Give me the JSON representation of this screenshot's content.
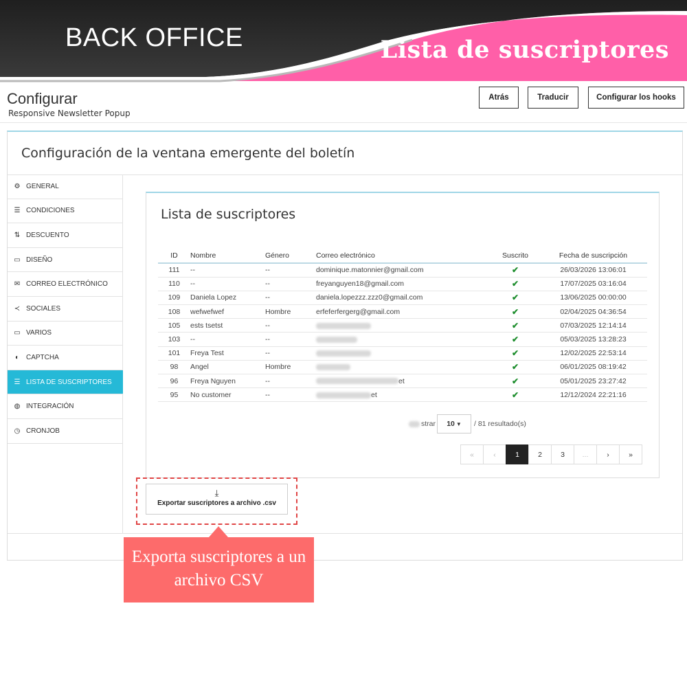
{
  "banner": {
    "left_title": "BACK OFFICE",
    "right_title": "Lista de suscriptores",
    "colors": {
      "dark": "#2b2b2b",
      "pink": "#ff5fa8"
    }
  },
  "header": {
    "title": "Configurar",
    "subtitle": "Responsive Newsletter Popup",
    "buttons": {
      "back": "Atrás",
      "translate": "Traducir",
      "hooks": "Configurar los hooks"
    }
  },
  "panel": {
    "title": "Configuración de la ventana emergente del boletín"
  },
  "sidebar": {
    "items": [
      {
        "label": "GENERAL",
        "icon": "cogs-icon"
      },
      {
        "label": "CONDICIONES",
        "icon": "list-icon"
      },
      {
        "label": "DESCUENTO",
        "icon": "sort-icon"
      },
      {
        "label": "DISEÑO",
        "icon": "window-icon"
      },
      {
        "label": "CORREO ELECTRÓNICO",
        "icon": "envelope-icon"
      },
      {
        "label": "SOCIALES",
        "icon": "share-icon"
      },
      {
        "label": "VARIOS",
        "icon": "desktop-icon"
      },
      {
        "label": "CAPTCHA",
        "icon": "shield-icon"
      },
      {
        "label": "LISTA DE SUSCRIPTORES",
        "icon": "list-icon",
        "active": true
      },
      {
        "label": "INTEGRACIÓN",
        "icon": "globe-icon"
      },
      {
        "label": "CRONJOB",
        "icon": "clock-icon"
      }
    ],
    "active_color": "#25b9d7"
  },
  "subscribers": {
    "title": "Lista de suscriptores",
    "columns": [
      "ID",
      "Nombre",
      "Género",
      "Correo electrónico",
      "Suscrito",
      "Fecha de suscripción"
    ],
    "rows": [
      {
        "id": "111",
        "name": "--",
        "gender": "--",
        "email": "dominique.matonnier@gmail.com",
        "date": "26/03/2026 13:06:01"
      },
      {
        "id": "110",
        "name": "--",
        "gender": "--",
        "email": "freyanguyen18@gmail.com",
        "date": "17/07/2025 03:16:04"
      },
      {
        "id": "109",
        "name": "Daniela Lopez",
        "gender": "--",
        "email": "daniela.lopezzz.zzz0@gmail.com",
        "date": "13/06/2025 00:00:00"
      },
      {
        "id": "108",
        "name": "wefwefwef",
        "gender": "Hombre",
        "email": "erfeferfergerg@gmail.com",
        "date": "02/04/2025 04:36:54"
      },
      {
        "id": "105",
        "name": "ests tsetst",
        "gender": "--",
        "email": "",
        "date": "07/03/2025 12:14:14"
      },
      {
        "id": "103",
        "name": "--",
        "gender": "--",
        "email": "",
        "date": "05/03/2025 13:28:23"
      },
      {
        "id": "101",
        "name": "Freya Test",
        "gender": "--",
        "email": "",
        "date": "12/02/2025 22:53:14"
      },
      {
        "id": "98",
        "name": "Angel",
        "gender": "Hombre",
        "email": "",
        "date": "06/01/2025 08:19:42"
      },
      {
        "id": "96",
        "name": "Freya Nguyen",
        "gender": "--",
        "email": "et",
        "date": "05/01/2025 23:27:42"
      },
      {
        "id": "95",
        "name": "No customer",
        "gender": "--",
        "email": "et",
        "date": "12/12/2024 22:21:16"
      }
    ],
    "subscribed_icon": "check-icon",
    "per_page_prefix": "strar",
    "per_page_value": "10",
    "results_text": "/ 81 resultado(s)",
    "pagination": {
      "first": "«",
      "prev": "‹",
      "pages": [
        "1",
        "2",
        "3"
      ],
      "ellipsis": "...",
      "next": "›",
      "last": "»",
      "current": "1"
    }
  },
  "export": {
    "icon": "download-icon",
    "label": "Exportar suscriptores a archivo .csv"
  },
  "callout": {
    "text": "Exporta suscriptores a un archivo CSV",
    "color": "#fd6b6b"
  }
}
